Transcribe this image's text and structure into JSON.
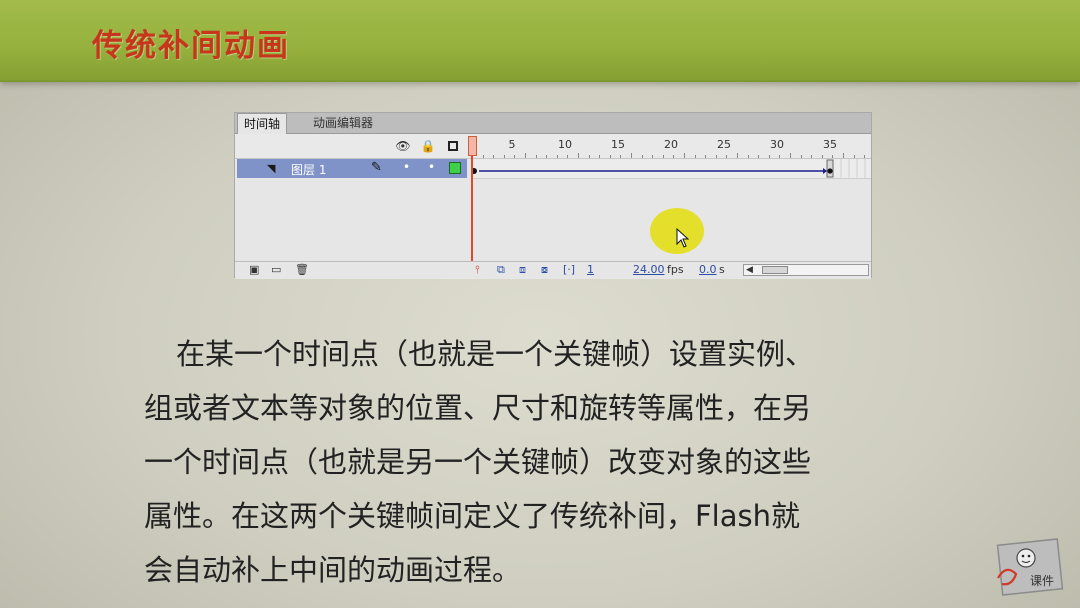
{
  "header": {
    "title": "传统补间动画"
  },
  "timeline": {
    "tabs": [
      "时间轴",
      "动画编辑器"
    ],
    "ruler_labels": [
      "5",
      "10",
      "15",
      "20",
      "25",
      "30",
      "35"
    ],
    "layer_name": "图层 1",
    "status": {
      "current_frame": "1",
      "fps": "24.00",
      "fps_unit": "fps",
      "time": "0.0",
      "time_unit": "s"
    }
  },
  "paragraph": {
    "lines": [
      "在某一个时间点（也就是一个关键帧）设置实例、",
      "组或者文本等对象的位置、尺寸和旋转等属性，在另",
      "一个时间点（也就是另一个关键帧）改变对象的这些",
      "属性。在这两个关键帧间定义了传统补间，Flash就",
      "会自动补上中间的动画过程。"
    ]
  },
  "logo": {
    "text": "课件"
  },
  "colors": {
    "header_bg": "#96b13d",
    "title": "#c7361b",
    "layer_selected": "#7f93c9",
    "playhead": "#e04a2a",
    "cursor_highlight": "#e4de1a"
  }
}
